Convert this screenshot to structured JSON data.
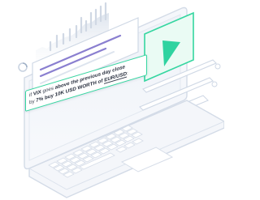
{
  "strategy_banner": {
    "line1": {
      "prefix": "if ",
      "vix": "VIX",
      "mid": " goes ",
      "above": "above",
      "rest": " the previous day close"
    },
    "line2": {
      "prefix": "by ",
      "pct": "7%",
      "mid": " buy ",
      "amount": "10K",
      "rest": " USD WORTH of ",
      "pair": "EUR/USD",
      "suffix": ":"
    }
  },
  "colors": {
    "accent_green": "#35d6a0",
    "play_green": "#2fd3a0",
    "panel_outline": "#c9d4e4",
    "purple_bar": "#8a7fd0"
  },
  "icons": [
    "play-icon",
    "refresh-icon",
    "chart-icon"
  ]
}
